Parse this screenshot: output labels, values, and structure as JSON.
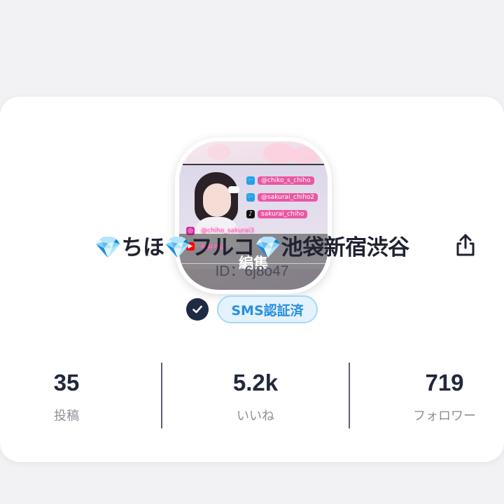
{
  "avatar": {
    "edit_label": "編集",
    "sns": [
      {
        "icon": "twitter-icon",
        "glyph": "🐦",
        "handle": "@chiko_s_chiho"
      },
      {
        "icon": "twitter-icon",
        "glyph": "🐦",
        "handle": "@sakurai_chiho2"
      },
      {
        "icon": "tiktok-icon",
        "glyph": "♪",
        "handle": "sakurai_chiho"
      },
      {
        "icon": "instagram-icon",
        "glyph": "◎",
        "handle": "@chiho_sakurai3"
      },
      {
        "icon": "youtube-icon",
        "glyph": "▶",
        "handle": "桜井ちほ"
      }
    ]
  },
  "profile": {
    "display_name": "💎ちほ💎フルコ💎池袋新宿渋谷",
    "user_id": "ID：6j8o47",
    "verification_label": "SMS認証済"
  },
  "stats": {
    "posts": {
      "value": "35",
      "label": "投稿"
    },
    "likes": {
      "value": "5.2k",
      "label": "いいね"
    },
    "followers": {
      "value": "719",
      "label": "フォロワー"
    }
  },
  "colors": {
    "badge_text": "#2a8fdc",
    "badge_bg": "#e3f2fd",
    "check_bg": "#1f2a44",
    "sns_pink": "#e958a4"
  }
}
